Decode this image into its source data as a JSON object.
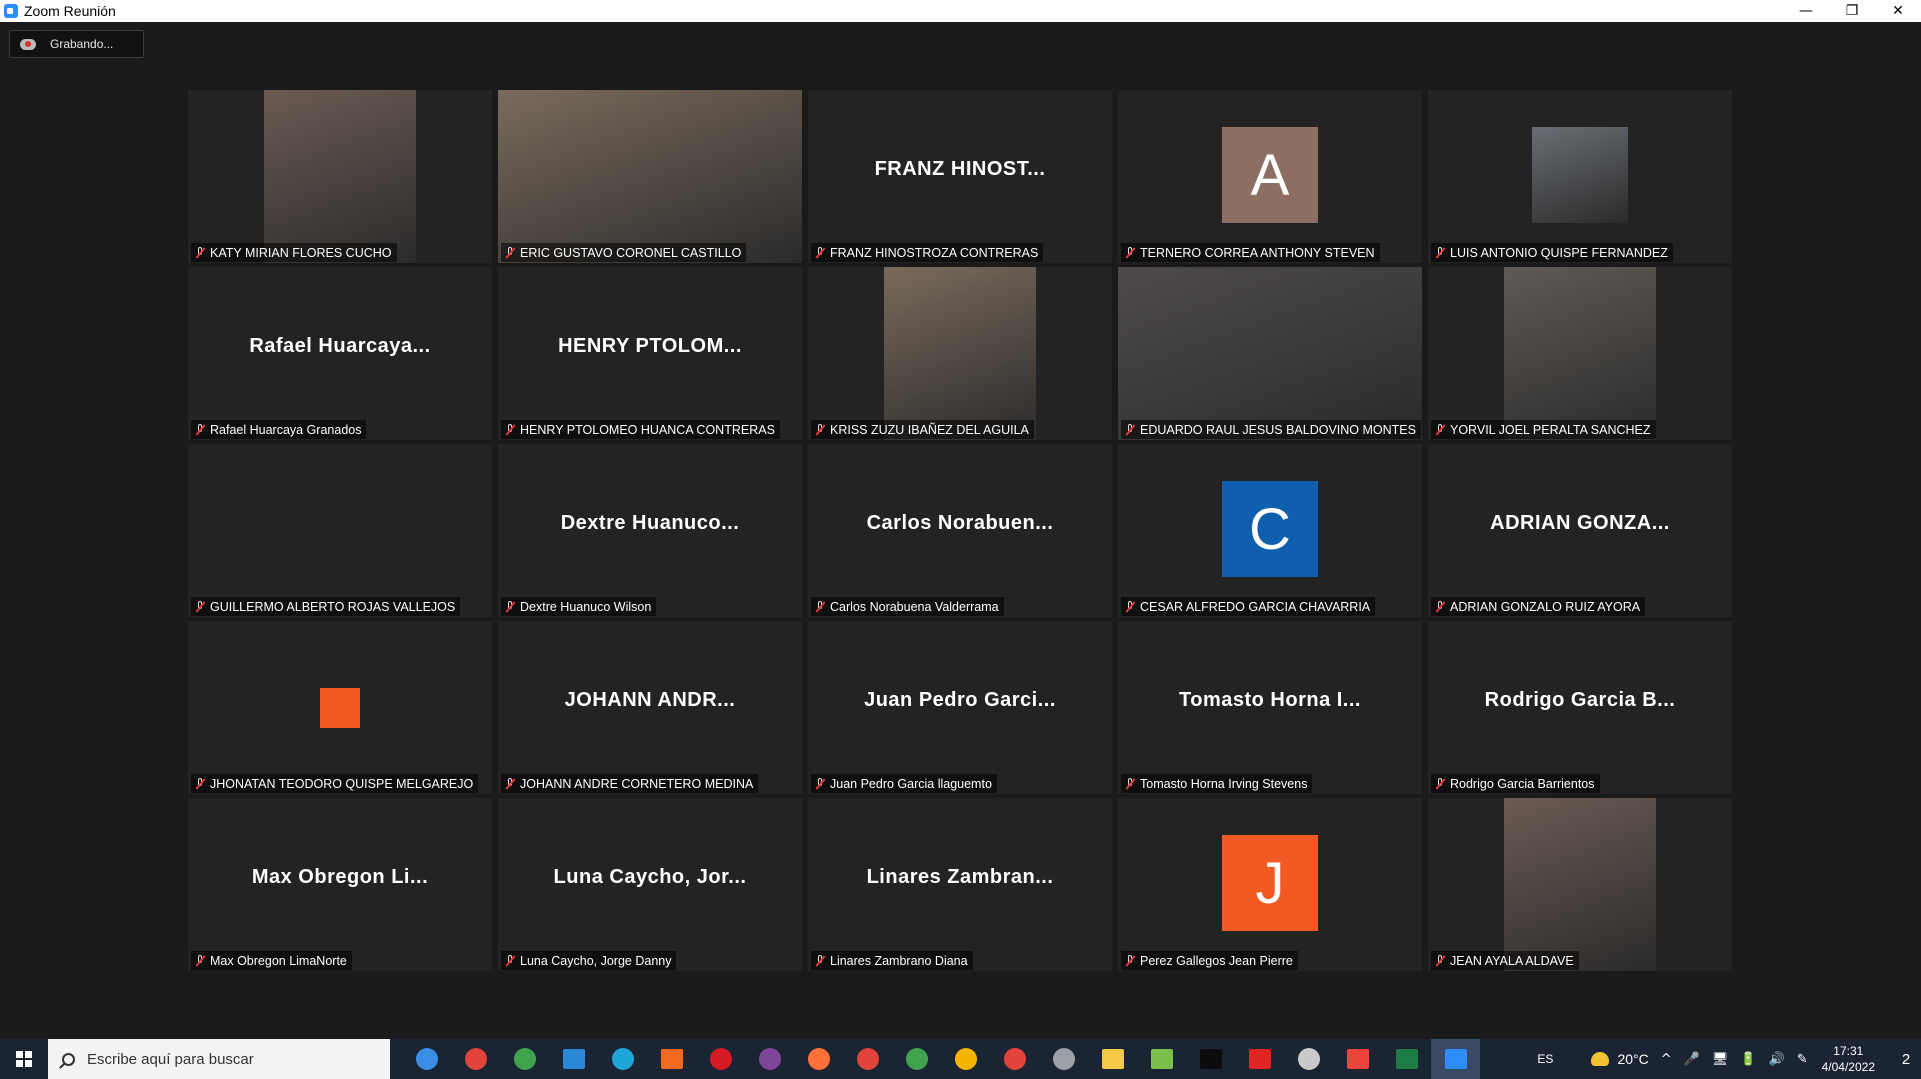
{
  "window": {
    "title": "Zoom Reunión",
    "controls": [
      "—",
      "❐",
      "✕"
    ]
  },
  "recording": {
    "label": "Grabando..."
  },
  "participants": [
    {
      "label": "KATY MIRIAN FLORES CUCHO",
      "display": "",
      "kind": "video",
      "active": false
    },
    {
      "label": "ERIC GUSTAVO CORONEL CASTILLO",
      "display": "",
      "kind": "video",
      "active": true
    },
    {
      "label": "FRANZ HINOSTROZA CONTRERAS",
      "display": "FRANZ  HINOST...",
      "kind": "name",
      "active": false
    },
    {
      "label": "TERNERO CORREA ANTHONY STEVEN",
      "display": "A",
      "kind": "avatar",
      "color": "#8d6e63",
      "active": false
    },
    {
      "label": "LUIS ANTONIO QUISPE FERNANDEZ",
      "display": "",
      "kind": "photo",
      "active": false
    },
    {
      "label": "Rafael Huarcaya Granados",
      "display": "Rafael  Huarcaya...",
      "kind": "name",
      "active": false
    },
    {
      "label": "HENRY PTOLOMEO HUANCA CONTRERAS",
      "display": "HENRY  PTOLOM...",
      "kind": "name",
      "active": false
    },
    {
      "label": "KRISS ZUZU IBAÑEZ DEL AGUILA",
      "display": "",
      "kind": "video",
      "active": false
    },
    {
      "label": "EDUARDO RAUL JESUS BALDOVINO MONTES",
      "display": "",
      "kind": "video",
      "active": false
    },
    {
      "label": "YORVIL JOEL PERALTA SANCHEZ",
      "display": "",
      "kind": "video",
      "active": false
    },
    {
      "label": "GUILLERMO ALBERTO ROJAS VALLEJOS",
      "display": "",
      "kind": "blank",
      "active": false
    },
    {
      "label": "Dextre Huanuco Wilson",
      "display": "Dextre  Huanuco...",
      "kind": "name",
      "active": false
    },
    {
      "label": "Carlos Norabuena Valderrama",
      "display": "Carlos  Norabuen...",
      "kind": "name",
      "active": false
    },
    {
      "label": "CESAR ALFREDO GARCIA CHAVARRIA",
      "display": "C",
      "kind": "avatar",
      "color": "#0f5fae",
      "active": false
    },
    {
      "label": "ADRIAN GONZALO RUIZ AYORA",
      "display": "ADRIAN  GONZA...",
      "kind": "name",
      "active": false
    },
    {
      "label": "JHONATAN TEODORO QUISPE MELGAREJO",
      "display": "",
      "kind": "square",
      "active": false
    },
    {
      "label": "JOHANN ANDRE CORNETERO MEDINA",
      "display": "JOHANN  ANDR...",
      "kind": "name",
      "active": false
    },
    {
      "label": "Juan Pedro Garcia llaguemto",
      "display": "Juan Pedro Garci...",
      "kind": "name",
      "active": false
    },
    {
      "label": "Tomasto Horna Irving Stevens",
      "display": "Tomasto Horna I...",
      "kind": "name",
      "active": false
    },
    {
      "label": "Rodrigo Garcia Barrientos",
      "display": "Rodrigo Garcia B...",
      "kind": "name",
      "active": false
    },
    {
      "label": "Max Obregon LimaNorte",
      "display": "Max Obregon Li...",
      "kind": "name",
      "active": false
    },
    {
      "label": "Luna Caycho, Jorge Danny",
      "display": "Luna Caycho, Jor...",
      "kind": "name",
      "active": false
    },
    {
      "label": "Linares Zambrano Diana",
      "display": "Linares  Zambran...",
      "kind": "name",
      "active": false
    },
    {
      "label": "Perez Gallegos Jean Pierre",
      "display": "J",
      "kind": "avatar",
      "color": "#f15a22",
      "active": false
    },
    {
      "label": "JEAN AYALA ALDAVE",
      "display": "",
      "kind": "video",
      "active": false
    }
  ],
  "taskbar": {
    "search_placeholder": "Escribe aquí para buscar",
    "apps": [
      {
        "name": "cortana-icon",
        "color": "#3a8ee6",
        "shape": "ic"
      },
      {
        "name": "chrome-icon",
        "color": "#e0443a",
        "shape": "ic"
      },
      {
        "name": "chrome-icon",
        "color": "#3fa34d",
        "shape": "ic"
      },
      {
        "name": "mail-icon",
        "color": "#2b88d8",
        "shape": "sq"
      },
      {
        "name": "edge-icon",
        "color": "#1fa5d8",
        "shape": "ic"
      },
      {
        "name": "brave-icon",
        "color": "#f26b21",
        "shape": "sq"
      },
      {
        "name": "opera-icon",
        "color": "#d61b25",
        "shape": "ic"
      },
      {
        "name": "tor-icon",
        "color": "#7d4698",
        "shape": "ic"
      },
      {
        "name": "firefox-icon",
        "color": "#ff7139",
        "shape": "ic"
      },
      {
        "name": "chrome-icon",
        "color": "#e0443a",
        "shape": "ic"
      },
      {
        "name": "chrome-icon",
        "color": "#3fa34d",
        "shape": "ic"
      },
      {
        "name": "chrome-icon",
        "color": "#f4b400",
        "shape": "ic"
      },
      {
        "name": "chrome-icon",
        "color": "#e0443a",
        "shape": "ic"
      },
      {
        "name": "pen-tool-icon",
        "color": "#9aa0a6",
        "shape": "ic"
      },
      {
        "name": "file-explorer-icon",
        "color": "#f7c948",
        "shape": "sq"
      },
      {
        "name": "notepad-icon",
        "color": "#7cbf4b",
        "shape": "sq"
      },
      {
        "name": "terminal-icon",
        "color": "#0c0c0c",
        "shape": "sq"
      },
      {
        "name": "pdf-icon",
        "color": "#e02424",
        "shape": "sq"
      },
      {
        "name": "cloud-app-icon",
        "color": "#c9c9c9",
        "shape": "ic"
      },
      {
        "name": "anydesk-icon",
        "color": "#ef443b",
        "shape": "sq"
      },
      {
        "name": "excel-icon",
        "color": "#1e7b45",
        "shape": "sq"
      },
      {
        "name": "zoom-icon",
        "color": "#2d8cff",
        "shape": "sq",
        "active": true
      }
    ],
    "tray": {
      "language": "ES",
      "temperature": "20°C",
      "icons": [
        "^",
        "🎤",
        "🖥",
        "🔋",
        "🔊",
        "✎"
      ],
      "time": "17:31",
      "date": "4/04/2022",
      "notifications": "2"
    }
  }
}
